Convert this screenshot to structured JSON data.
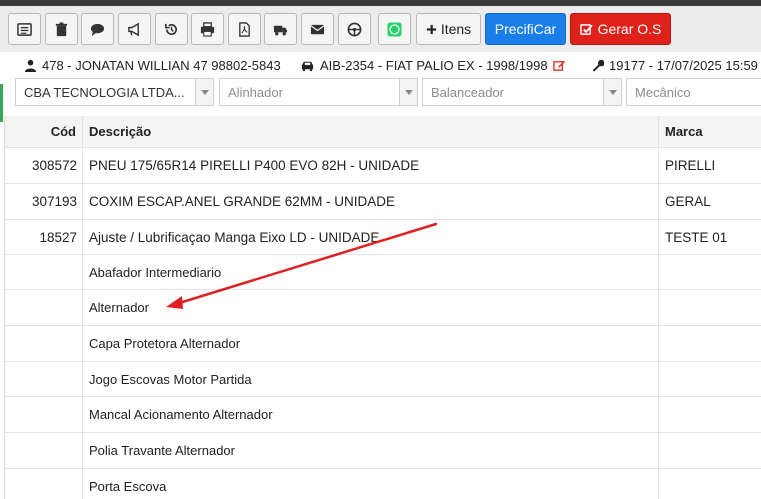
{
  "toolbar": {
    "icons": [
      "list-icon",
      "trash-icon",
      "comment-icon",
      "megaphone-icon",
      "history-icon",
      "print-icon",
      "pdf-icon",
      "truck-icon",
      "envelope-icon",
      "steering-wheel-icon",
      "whatsapp-icon"
    ],
    "itens_label": "Itens",
    "precificar_label": "PrecifiCar",
    "gerar_os_label": "Gerar O.S"
  },
  "info": {
    "client": "478 - JONATAN WILLIAN 47 98802-5843",
    "vehicle": "AIB-2354 - FIAT PALIO EX - 1998/1998",
    "order": "19177 - 17/07/2025 15:59"
  },
  "filters": {
    "company": "CBA TECNOLOGIA LTDA...",
    "alinhador": "Alinhador",
    "balanceador": "Balanceador",
    "mecanico": "Mecânico"
  },
  "table": {
    "headers": {
      "cod": "Cód",
      "descricao": "Descrição",
      "marca": "Marca"
    },
    "rows": [
      {
        "cod": "308572",
        "descricao": "PNEU 175/65R14 PIRELLI P400 EVO 82H - UNIDADE",
        "marca": "PIRELLI"
      },
      {
        "cod": "307193",
        "descricao": "COXIM ESCAP.ANEL GRANDE 62MM - UNIDADE",
        "marca": "GERAL"
      },
      {
        "cod": "18527",
        "descricao": "Ajuste / Lubrificaçao Manga Eixo LD - UNIDADE",
        "marca": "TESTE 01"
      },
      {
        "cod": "",
        "descricao": "Abafador Intermediario",
        "marca": ""
      },
      {
        "cod": "",
        "descricao": "Alternador",
        "marca": ""
      },
      {
        "cod": "",
        "descricao": "Capa Protetora Alternador",
        "marca": ""
      },
      {
        "cod": "",
        "descricao": "Jogo Escovas Motor Partida",
        "marca": ""
      },
      {
        "cod": "",
        "descricao": "Mancal Acionamento Alternador",
        "marca": ""
      },
      {
        "cod": "",
        "descricao": "Polia Travante Alternador",
        "marca": ""
      },
      {
        "cod": "",
        "descricao": "Porta Escova",
        "marca": ""
      }
    ]
  },
  "colors": {
    "primary": "#1a7ee8",
    "danger": "#e0201a",
    "annotation": "#e02020",
    "whatsapp": "#25d366"
  }
}
